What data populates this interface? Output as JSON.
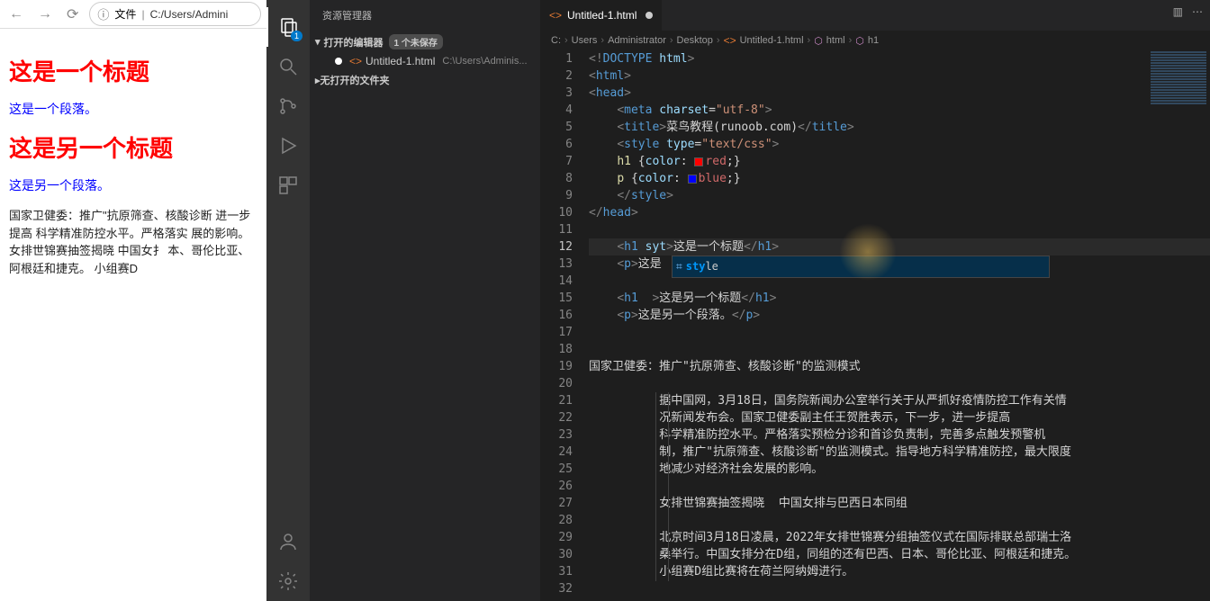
{
  "browser": {
    "url_prefix": "文件",
    "url": "C:/Users/Admini",
    "content": {
      "h1_a": "这是一个标题",
      "p_a": "这是一个段落。",
      "h1_b": "这是另一个标题",
      "p_b": "这是另一个段落。",
      "article": "国家卫健委：推广\"抗原筛查、核酸诊断 进一步提高 科学精准防控水平。严格落实 展的影响。 女排世锦赛抽签揭晓 中国女扌 本、哥伦比亚、阿根廷和捷克。 小组赛D"
    }
  },
  "vscode": {
    "explorer_title": "资源管理器",
    "open_editors": "打开的编辑器",
    "unsaved_badge": "1 个未保存",
    "file_name": "Untitled-1.html",
    "file_path": "C:\\Users\\Adminis...",
    "no_folder": "无打开的文件夹",
    "activity_badge": "1",
    "tab": {
      "name": "Untitled-1.html"
    },
    "breadcrumb": [
      "C:",
      "Users",
      "Administrator",
      "Desktop",
      "Untitled-1.html",
      "html",
      "h1"
    ],
    "suggest": {
      "label": "style",
      "match_prefix": "sty"
    },
    "code": {
      "l1": "<!DOCTYPE html>",
      "l2": "<html>",
      "l3": "<head>",
      "l4_meta": "    <meta charset=\"utf-8\">",
      "l5_title_text": "菜鸟教程(runoob.com)",
      "l6_style_attr": "text/css",
      "l7": "    h1 {color: red;}",
      "l8": "    p {color: blue;}",
      "l9": "    </style>",
      "l10": "</head>",
      "l12_h1": "这是一个标题",
      "l12_attr": "syt",
      "l13_p": "这是",
      "l15_h1": "这是另一个标题",
      "l16_p": "这是另一个段落。",
      "l19": "国家卫健委：推广\"抗原筛查、核酸诊断\"的监测模式",
      "l21": "据中国网，3月18日，国务院新闻办公室举行关于从严抓好疫情防控工作有关情",
      "l22": "况新闻发布会。国家卫健委副主任王贺胜表示，下一步，进一步提高",
      "l23": "科学精准防控水平。严格落实预检分诊和首诊负责制，完善多点触发预警机",
      "l24": "制，推广\"抗原筛查、核酸诊断\"的监测模式。指导地方科学精准防控，最大限度",
      "l25": "地减少对经济社会发展的影响。",
      "l27": "女排世锦赛抽签揭晓  中国女排与巴西日本同组",
      "l29": "北京时间3月18日凌晨，2022年女排世锦赛分组抽签仪式在国际排联总部瑞士洛",
      "l30": "桑举行。中国女排分在D组，同组的还有巴西、日本、哥伦比亚、阿根廷和捷克。",
      "l31": "小组赛D组比赛将在荷兰阿纳姆进行。"
    }
  }
}
